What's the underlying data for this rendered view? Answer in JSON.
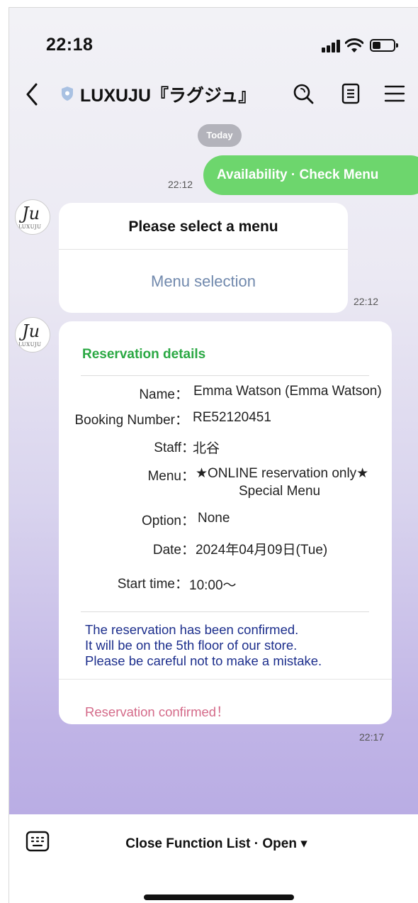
{
  "status_bar": {
    "time": "22:18"
  },
  "header": {
    "title": "LUXUJU『ラグジュ』"
  },
  "date_chip": "Today",
  "messages": {
    "sent": {
      "text": "Availability · Check Menu",
      "time": "22:12"
    },
    "menu_card": {
      "avatar_mark": "Ju",
      "avatar_sub": "LUXUJU",
      "title": "Please select a menu",
      "link": "Menu selection",
      "time": "22:12"
    },
    "reservation": {
      "title": "Reservation details",
      "rows": [
        {
          "label": "Name：",
          "value": "Emma Watson (Emma Watson)"
        },
        {
          "label": "Booking Number：",
          "value": "RE52120451"
        },
        {
          "label": "Staff：",
          "value": "北谷"
        },
        {
          "label": "Menu：",
          "value": "★ONLINE reservation only★",
          "value2": "Special Menu"
        },
        {
          "label": "Option：",
          "value": "None"
        },
        {
          "label": "Date：",
          "value": "2024年04月09日(Tue)"
        },
        {
          "label": "Start time：",
          "value": "10:00～"
        }
      ],
      "notice": [
        "The reservation has been confirmed.",
        "It will be on the 5th floor of our store.",
        "Please be careful not to make a mistake."
      ],
      "confirmed": "Reservation confirmed！",
      "time": "22:17"
    }
  },
  "bottom_bar": {
    "function_list": "Close Function List · Open ▾"
  },
  "colors": {
    "sent_bubble": "#6dd66d",
    "title_green": "#2aa843",
    "notice_blue": "#1c2e8c",
    "confirmed_pink": "#d46a89",
    "link_blue": "#7189ad"
  }
}
